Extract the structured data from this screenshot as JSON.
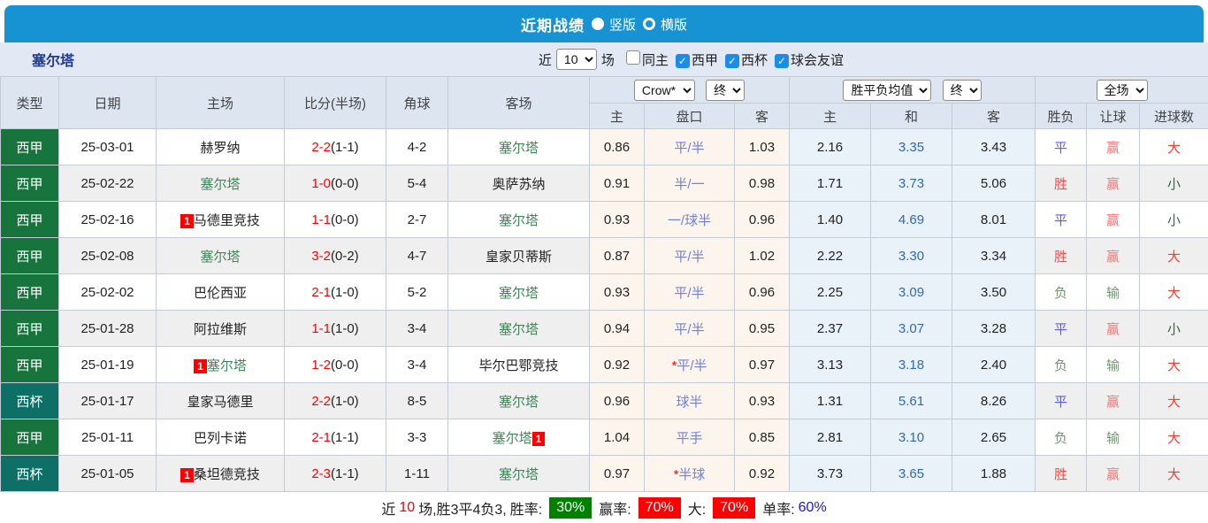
{
  "title_bar": {
    "title": "近期战绩",
    "radio_vertical_label": "竖版",
    "radio_horizontal_label": "横版"
  },
  "filter_bar": {
    "team": "塞尔塔",
    "recent_label": "近",
    "recent_value": "10",
    "matches_label": "场",
    "checkboxes": [
      {
        "label": "同主",
        "checked": false
      },
      {
        "label": "西甲",
        "checked": true
      },
      {
        "label": "西杯",
        "checked": true
      },
      {
        "label": "球会友谊",
        "checked": true
      }
    ]
  },
  "table": {
    "headers": {
      "type": "类型",
      "date": "日期",
      "home": "主场",
      "score": "比分(半场)",
      "corner": "角球",
      "away": "客场",
      "odds_source_select": "Crow*",
      "odds_stage_select": "终",
      "avg_type_select": "胜平负均值",
      "avg_stage_select": "终",
      "scope_select": "全场",
      "sub_home": "主",
      "sub_handicap": "盘口",
      "sub_away": "客",
      "sub_avg_home": "主",
      "sub_avg_draw": "和",
      "sub_avg_away": "客",
      "sub_outcome": "胜负",
      "sub_handicap_result": "让球",
      "sub_goals": "进球数"
    },
    "rows": [
      {
        "league": "西甲",
        "kind": "league",
        "date": "25-03-01",
        "home": {
          "name": "赫罗纳",
          "celta": false,
          "badge": "",
          "badge_pos": ""
        },
        "score_ft": "2-2",
        "score_ht": "(1-1)",
        "corner": "4-2",
        "away": {
          "name": "塞尔塔",
          "celta": true,
          "badge": "",
          "badge_pos": ""
        },
        "odds_home": "0.86",
        "handicap": "平/半",
        "odds_away": "1.03",
        "avg_home": "2.16",
        "avg_draw": "3.35",
        "avg_away": "3.43",
        "outcome": "平",
        "handicap_result": "赢",
        "goals": "大"
      },
      {
        "league": "西甲",
        "kind": "league",
        "date": "25-02-22",
        "home": {
          "name": "塞尔塔",
          "celta": true,
          "badge": "",
          "badge_pos": ""
        },
        "score_ft": "1-0",
        "score_ht": "(0-0)",
        "corner": "5-4",
        "away": {
          "name": "奥萨苏纳",
          "celta": false,
          "badge": "",
          "badge_pos": ""
        },
        "odds_home": "0.91",
        "handicap": "半/一",
        "odds_away": "0.98",
        "avg_home": "1.71",
        "avg_draw": "3.73",
        "avg_away": "5.06",
        "outcome": "胜",
        "handicap_result": "赢",
        "goals": "小"
      },
      {
        "league": "西甲",
        "kind": "league",
        "date": "25-02-16",
        "home": {
          "name": "马德里竞技",
          "celta": false,
          "badge": "1",
          "badge_pos": "before"
        },
        "score_ft": "1-1",
        "score_ht": "(0-0)",
        "corner": "2-7",
        "away": {
          "name": "塞尔塔",
          "celta": true,
          "badge": "",
          "badge_pos": ""
        },
        "odds_home": "0.93",
        "handicap": "一/球半",
        "odds_away": "0.96",
        "avg_home": "1.40",
        "avg_draw": "4.69",
        "avg_away": "8.01",
        "outcome": "平",
        "handicap_result": "赢",
        "goals": "小"
      },
      {
        "league": "西甲",
        "kind": "league",
        "date": "25-02-08",
        "home": {
          "name": "塞尔塔",
          "celta": true,
          "badge": "",
          "badge_pos": ""
        },
        "score_ft": "3-2",
        "score_ht": "(0-2)",
        "corner": "4-7",
        "away": {
          "name": "皇家贝蒂斯",
          "celta": false,
          "badge": "",
          "badge_pos": ""
        },
        "odds_home": "0.87",
        "handicap": "平/半",
        "odds_away": "1.02",
        "avg_home": "2.22",
        "avg_draw": "3.30",
        "avg_away": "3.34",
        "outcome": "胜",
        "handicap_result": "赢",
        "goals": "大"
      },
      {
        "league": "西甲",
        "kind": "league",
        "date": "25-02-02",
        "home": {
          "name": "巴伦西亚",
          "celta": false,
          "badge": "",
          "badge_pos": ""
        },
        "score_ft": "2-1",
        "score_ht": "(1-0)",
        "corner": "5-2",
        "away": {
          "name": "塞尔塔",
          "celta": true,
          "badge": "",
          "badge_pos": ""
        },
        "odds_home": "0.93",
        "handicap": "平/半",
        "odds_away": "0.96",
        "avg_home": "2.25",
        "avg_draw": "3.09",
        "avg_away": "3.50",
        "outcome": "负",
        "handicap_result": "输",
        "goals": "大"
      },
      {
        "league": "西甲",
        "kind": "league",
        "date": "25-01-28",
        "home": {
          "name": "阿拉维斯",
          "celta": false,
          "badge": "",
          "badge_pos": ""
        },
        "score_ft": "1-1",
        "score_ht": "(1-0)",
        "corner": "3-4",
        "away": {
          "name": "塞尔塔",
          "celta": true,
          "badge": "",
          "badge_pos": ""
        },
        "odds_home": "0.94",
        "handicap": "平/半",
        "odds_away": "0.95",
        "avg_home": "2.37",
        "avg_draw": "3.07",
        "avg_away": "3.28",
        "outcome": "平",
        "handicap_result": "赢",
        "goals": "小"
      },
      {
        "league": "西甲",
        "kind": "league",
        "date": "25-01-19",
        "home": {
          "name": "塞尔塔",
          "celta": true,
          "badge": "1",
          "badge_pos": "before"
        },
        "score_ft": "1-2",
        "score_ht": "(0-0)",
        "corner": "3-4",
        "away": {
          "name": "毕尔巴鄂竞技",
          "celta": false,
          "badge": "",
          "badge_pos": ""
        },
        "odds_home": "0.92",
        "handicap": "*平/半",
        "odds_away": "0.97",
        "avg_home": "3.13",
        "avg_draw": "3.18",
        "avg_away": "2.40",
        "outcome": "负",
        "handicap_result": "输",
        "goals": "大"
      },
      {
        "league": "西杯",
        "kind": "cup",
        "date": "25-01-17",
        "home": {
          "name": "皇家马德里",
          "celta": false,
          "badge": "",
          "badge_pos": ""
        },
        "score_ft": "2-2",
        "score_ht": "(1-0)",
        "corner": "8-5",
        "away": {
          "name": "塞尔塔",
          "celta": true,
          "badge": "",
          "badge_pos": ""
        },
        "odds_home": "0.96",
        "handicap": "球半",
        "odds_away": "0.93",
        "avg_home": "1.31",
        "avg_draw": "5.61",
        "avg_away": "8.26",
        "outcome": "平",
        "handicap_result": "赢",
        "goals": "大"
      },
      {
        "league": "西甲",
        "kind": "league",
        "date": "25-01-11",
        "home": {
          "name": "巴列卡诺",
          "celta": false,
          "badge": "",
          "badge_pos": ""
        },
        "score_ft": "2-1",
        "score_ht": "(1-1)",
        "corner": "3-3",
        "away": {
          "name": "塞尔塔",
          "celta": true,
          "badge": "1",
          "badge_pos": "after"
        },
        "odds_home": "1.04",
        "handicap": "平手",
        "odds_away": "0.85",
        "avg_home": "2.81",
        "avg_draw": "3.10",
        "avg_away": "2.65",
        "outcome": "负",
        "handicap_result": "输",
        "goals": "大"
      },
      {
        "league": "西杯",
        "kind": "cup",
        "date": "25-01-05",
        "home": {
          "name": "桑坦德竞技",
          "celta": false,
          "badge": "1",
          "badge_pos": "before"
        },
        "score_ft": "2-3",
        "score_ht": "(1-1)",
        "corner": "1-11",
        "away": {
          "name": "塞尔塔",
          "celta": true,
          "badge": "",
          "badge_pos": ""
        },
        "odds_home": "0.97",
        "handicap": "*半球",
        "odds_away": "0.92",
        "avg_home": "3.73",
        "avg_draw": "3.65",
        "avg_away": "1.88",
        "outcome": "胜",
        "handicap_result": "赢",
        "goals": "大"
      }
    ]
  },
  "summary": {
    "prefix": "近",
    "count": "10",
    "mid": "场,胜3平4负3, ",
    "win_rate_label": "胜率:",
    "win_rate": "30%",
    "ying_label": "赢率:",
    "ying_rate": "70%",
    "big_label": "大:",
    "big_rate": "70%",
    "single_label": "单率:",
    "single_rate": "60%"
  },
  "colors": {
    "accent_blue": "#1793d4",
    "league_green": "#16743c",
    "cup_teal": "#0d6f65",
    "score_red": "#fe0000",
    "celta_green": "#41865a",
    "handicap_blue": "#7280d8",
    "avg_blue": "#3168b4",
    "pill_green": "#008000",
    "pill_red": "#fe0000"
  }
}
